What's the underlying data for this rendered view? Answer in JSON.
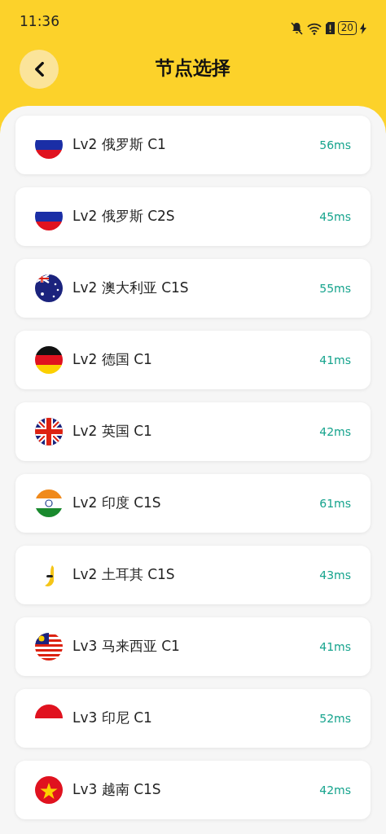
{
  "status_bar": {
    "time": "11:36",
    "battery": "20"
  },
  "header": {
    "title": "节点选择"
  },
  "nodes": [
    {
      "kind": "ru",
      "name": "Lv2 俄罗斯 C1",
      "latency": "56ms"
    },
    {
      "kind": "ru",
      "name": "Lv2 俄罗斯 C2S",
      "latency": "45ms"
    },
    {
      "kind": "au",
      "name": "Lv2 澳大利亚 C1S",
      "latency": "55ms"
    },
    {
      "kind": "de",
      "name": "Lv2 德国 C1",
      "latency": "41ms"
    },
    {
      "kind": "gb",
      "name": "Lv2 英国 C1",
      "latency": "42ms"
    },
    {
      "kind": "in",
      "name": "Lv2 印度 C1S",
      "latency": "61ms"
    },
    {
      "kind": "banana",
      "name": "Lv2 土耳其 C1S",
      "latency": "43ms"
    },
    {
      "kind": "my",
      "name": "Lv3 马来西亚 C1",
      "latency": "41ms"
    },
    {
      "kind": "id",
      "name": "Lv3 印尼 C1",
      "latency": "52ms"
    },
    {
      "kind": "vn",
      "name": "Lv3 越南 C1S",
      "latency": "42ms"
    }
  ]
}
